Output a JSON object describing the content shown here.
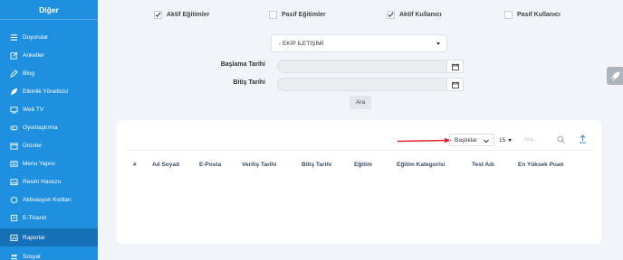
{
  "sidebar": {
    "header": "Diğer",
    "items": [
      {
        "label": "Duyurular",
        "icon": "list-icon"
      },
      {
        "label": "Anketler",
        "icon": "edit-icon"
      },
      {
        "label": "Blog",
        "icon": "pencil-icon"
      },
      {
        "label": "Etkinlik Yöneticisi",
        "icon": "rocket-icon"
      },
      {
        "label": "Web TV",
        "icon": "tv-icon"
      },
      {
        "label": "Oyunlaştırma",
        "icon": "gamepad-icon"
      },
      {
        "label": "Ürünler",
        "icon": "box-icon"
      },
      {
        "label": "Menu Yapısı",
        "icon": "menu-icon"
      },
      {
        "label": "Resim Havuzu",
        "icon": "image-icon"
      },
      {
        "label": "Aktivasyon Kodları",
        "icon": "badge-icon"
      },
      {
        "label": "E-Ticaret",
        "icon": "cart-icon"
      },
      {
        "label": "Raporlar",
        "icon": "report-icon"
      },
      {
        "label": "Sosyal",
        "icon": "users-icon"
      }
    ]
  },
  "filters": {
    "active_trainings": {
      "label": "Aktif Eğitimler",
      "checked": true
    },
    "passive_trainings": {
      "label": "Pasif Eğitimler",
      "checked": false
    },
    "active_users": {
      "label": "Aktif Kullanıcı",
      "checked": true
    },
    "passive_users": {
      "label": "Pasif Kullanıcı",
      "checked": false
    }
  },
  "team_select": {
    "value": "- EKİP İLETİŞİMİ"
  },
  "start_date": {
    "label": "Başlama Tarihi",
    "value": ""
  },
  "end_date": {
    "label": "Bitiş Tarihi",
    "value": ""
  },
  "search_button": "Ara",
  "table": {
    "headings_select": "Başlıklar",
    "page_size": "15",
    "search_placeholder": "Ara...",
    "columns": [
      "#",
      "Ad Soyad",
      "E-Posta",
      "Veriliş Tarihi",
      "Bitiş Tarihi",
      "Eğitim",
      "Eğitim Kategorisi",
      "Test Adı",
      "En Yüksek Puan"
    ],
    "rows": []
  },
  "colors": {
    "sidebar": "#1f8fe0",
    "sidebar_active": "#1670b8",
    "arrow": "#e0262a",
    "header_text": "#3a4a66"
  }
}
